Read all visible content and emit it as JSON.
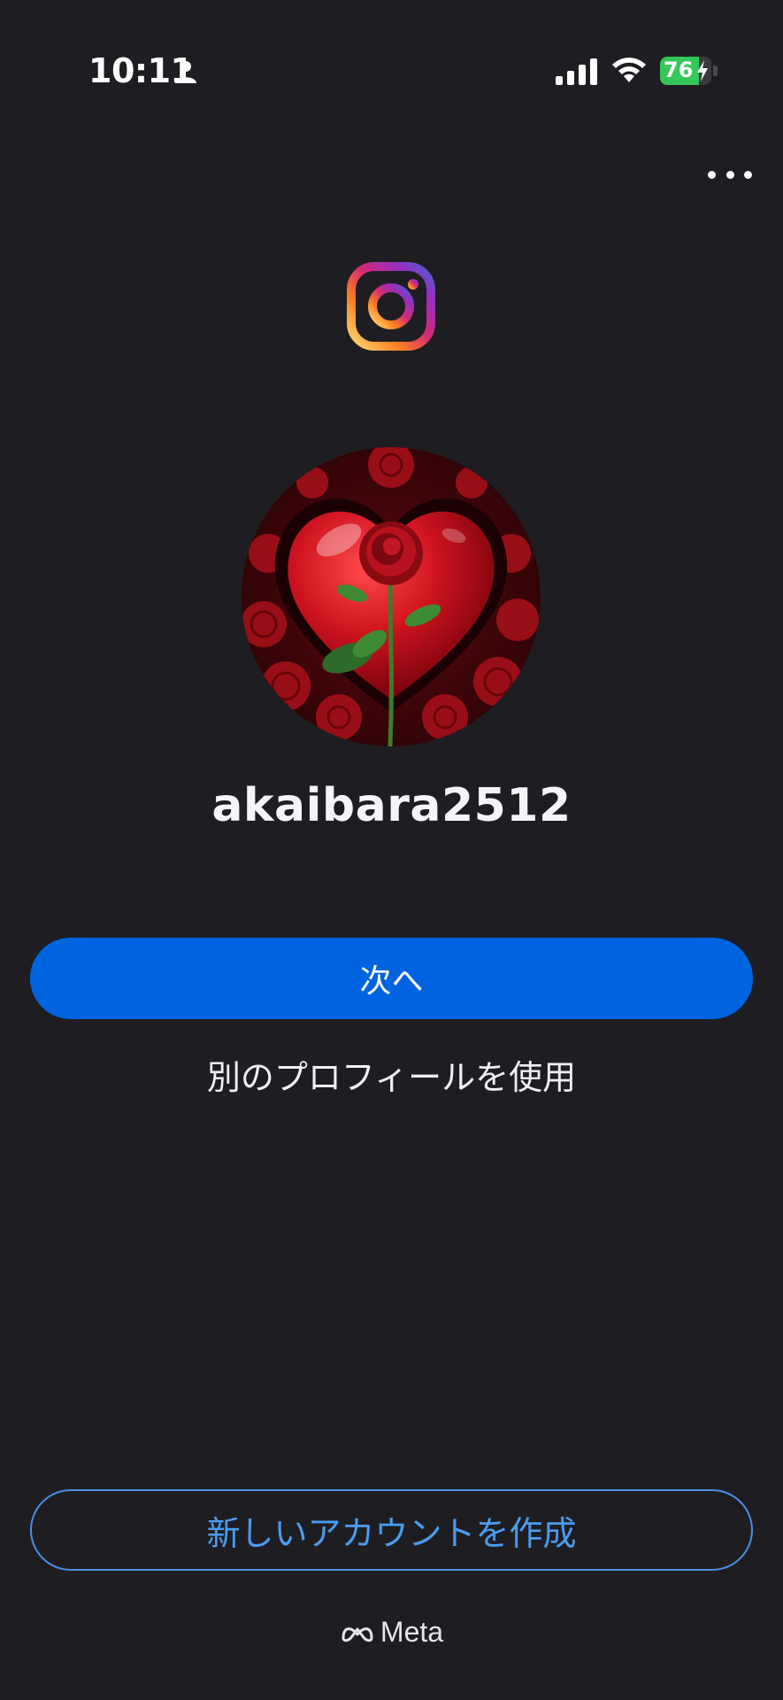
{
  "status_bar": {
    "time": "10:11",
    "battery_level": 76,
    "battery_label": "76",
    "icons": [
      "person-icon",
      "signal-icon",
      "wifi-icon",
      "battery-icon",
      "bolt-icon"
    ]
  },
  "header": {
    "more_icon": "more-horizontal-icon",
    "logo": "instagram-logo"
  },
  "profile": {
    "username": "akaibara2512",
    "avatar": "heart-with-rose"
  },
  "actions": {
    "next_label": "次へ",
    "other_profile_label": "別のプロフィールを使用",
    "create_account_label": "新しいアカウントを作成"
  },
  "footer": {
    "brand": "Meta"
  },
  "colors": {
    "background": "#1e1e22",
    "primary": "#0064e0",
    "outline": "#4a8fe6",
    "battery": "#34c759"
  }
}
